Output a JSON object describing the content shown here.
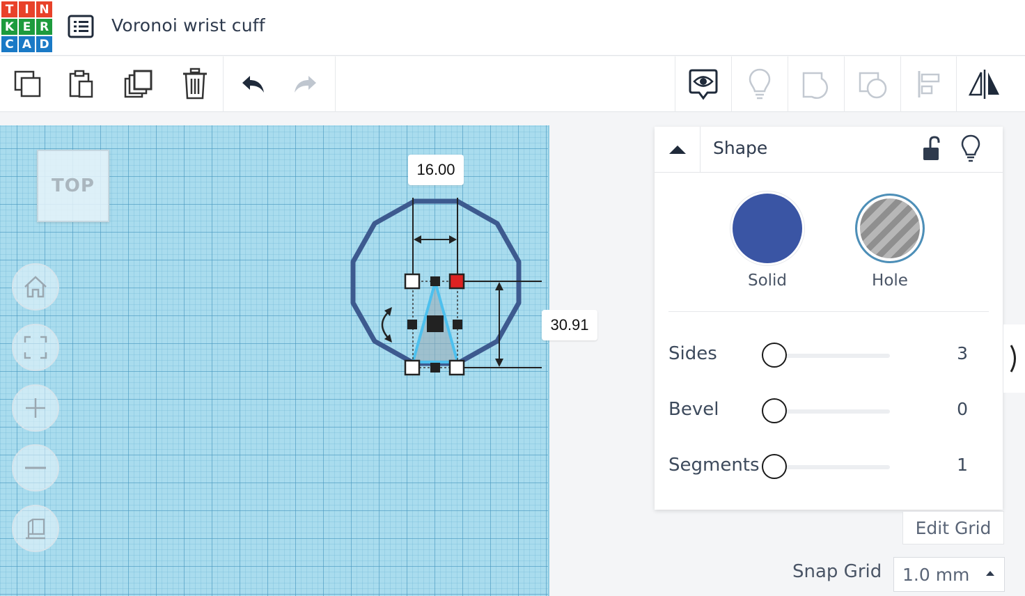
{
  "header": {
    "logo_letters": [
      "T",
      "I",
      "N",
      "K",
      "E",
      "R",
      "C",
      "A",
      "D"
    ],
    "logo_colors": [
      "#e8422a",
      "#e8422a",
      "#e8422a",
      "#1d9b3d",
      "#1d9b3d",
      "#1d9b3d",
      "#1a7ac6",
      "#1a7ac6",
      "#1a7ac6"
    ],
    "design_title": "Voronoi wrist cuff"
  },
  "toolbar": {
    "left_tools": [
      "copy-icon",
      "paste-icon",
      "duplicate-icon",
      "delete-icon",
      "undo-icon",
      "redo-icon"
    ],
    "right_tools": [
      "notes-icon",
      "light-bulb-icon",
      "group-icon",
      "ungroup-icon",
      "align-icon",
      "mirror-icon"
    ]
  },
  "workplane": {
    "view_cube_label": "TOP",
    "view_buttons": [
      "home-icon",
      "fit-all-icon",
      "zoom-in-icon",
      "zoom-out-icon",
      "projection-icon"
    ],
    "width_label": "16.00",
    "height_label": "30.91",
    "colors": {
      "grid_bg": "#a9dcee",
      "shape_outline": "#3d5a8f",
      "handle_red": "#dd2222"
    }
  },
  "shape_panel": {
    "title": "Shape",
    "solid_label": "Solid",
    "hole_label": "Hole",
    "solid_color": "#3a55a4",
    "params": [
      {
        "label": "Sides",
        "value": "3"
      },
      {
        "label": "Bevel",
        "value": "0"
      },
      {
        "label": "Segments",
        "value": "1"
      }
    ]
  },
  "grid": {
    "edit_label": "Edit Grid",
    "snap_label": "Snap Grid",
    "snap_value": "1.0 mm"
  }
}
